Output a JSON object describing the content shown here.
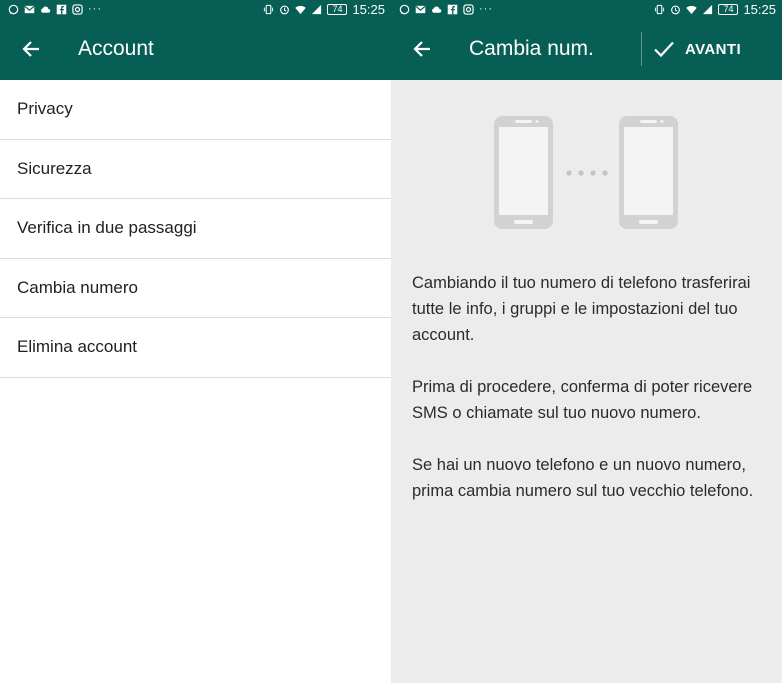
{
  "colors": {
    "toolbar": "#075e54",
    "text_primary": "#212121",
    "divider": "#dcdcdc",
    "right_background": "#ececec",
    "illustration": "#cfcfcf"
  },
  "status_bar": {
    "time": "15:25",
    "battery": "74",
    "overflow": "···",
    "left_icons": [
      "whatsapp-icon",
      "gmail-icon",
      "cloud-icon",
      "facebook-icon",
      "instagram-icon"
    ],
    "right_icons": [
      "vibrate-icon",
      "alarm-icon",
      "wifi-icon",
      "signal-icon",
      "battery-icon"
    ]
  },
  "left_screen": {
    "title": "Account",
    "back_icon": "arrow-back-icon",
    "menu_items": [
      {
        "label": "Privacy"
      },
      {
        "label": "Sicurezza"
      },
      {
        "label": "Verifica in due passaggi"
      },
      {
        "label": "Cambia numero"
      },
      {
        "label": "Elimina account"
      }
    ]
  },
  "right_screen": {
    "title": "Cambia num.",
    "back_icon": "arrow-back-icon",
    "action_icon": "check-icon",
    "action_label": "AVANTI",
    "illustration": "two-phones-transfer-icon",
    "paragraphs": [
      "Cambiando il tuo numero di telefono trasferirai tutte le info, i gruppi e le impostazioni del tuo account.",
      "Prima di procedere, conferma di poter ricevere SMS o chiamate sul tuo nuovo numero.",
      "Se hai un nuovo telefono e un nuovo numero, prima cambia numero sul tuo vecchio telefono."
    ]
  }
}
